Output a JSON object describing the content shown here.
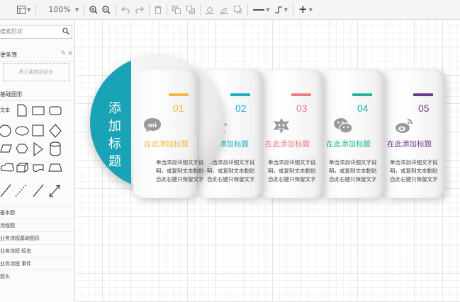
{
  "toolbar": {
    "zoom": "100%"
  },
  "sidebar": {
    "search_placeholder": "搜索形状",
    "scratchpad_title": "便条簿",
    "scratchpad_hint": "将元素拖到此处",
    "general_title": "基础图形",
    "text_label": "文本",
    "items": [
      "基本图",
      "流程图",
      "业务流程基础图形",
      "业务流程 标志",
      "业务流程 事件",
      "箭头"
    ]
  },
  "diagram": {
    "title_chars": [
      "添",
      "加",
      "标",
      "题"
    ],
    "title_color": "#1aa3b6",
    "cards": [
      {
        "num": "01",
        "heading": "在此添加标题",
        "color": "#f6b73c",
        "icon": "mi-icon",
        "body": [
          "单击添加详细文字说",
          "明，或复制文本黏贴",
          "自此右键只保留文字"
        ]
      },
      {
        "num": "02",
        "heading": "在此添加标题",
        "color": "#1ab0c5",
        "icon": "z-icon",
        "body": [
          "单击添加详细文字说",
          "明，或复制文本黏贴",
          "自此右键只保留文字"
        ]
      },
      {
        "num": "03",
        "heading": "在此添加标题",
        "color": "#f07d82",
        "icon": "star-face-icon",
        "body": [
          "单击添加详细文字说",
          "明，或复制文本黏贴",
          "自此右键只保留文字"
        ]
      },
      {
        "num": "04",
        "heading": "在此添加标题",
        "color": "#1fb59c",
        "icon": "wechat-icon",
        "body": [
          "单击添加详细文字说",
          "明，或复制文本黏贴",
          "自此右键只保留文字"
        ]
      },
      {
        "num": "05",
        "heading": "在此添加标题",
        "color": "#6d3a8a",
        "icon": "weibo-icon",
        "body": [
          "单击添加详细文字说",
          "明，或复制文本黏贴",
          "自此右键只保留文字"
        ]
      }
    ]
  }
}
